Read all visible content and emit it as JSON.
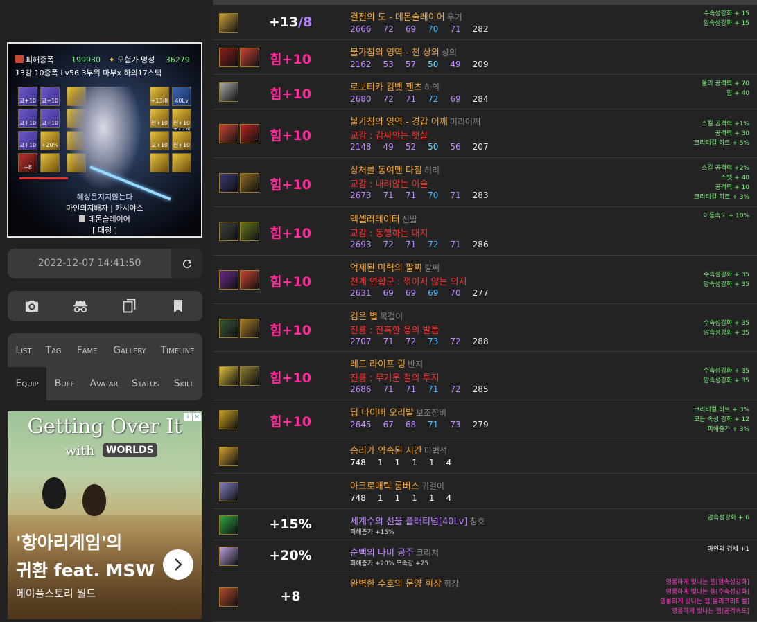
{
  "character": {
    "guild_icon": "guild-emblem-icon",
    "guild": "피해증폭",
    "guild_value": "199930",
    "fame_icon": "fame-icon",
    "fame_label": "모험가 명성",
    "fame_value": "36279",
    "summary": "13강 10증폭 Lv56 3부위 마부x 하의17스택",
    "title_text": "혜성은지지않는다",
    "adventure": "마인의지배자 | 카시야스",
    "name": "데몬슬레이어",
    "job": "[ 대청 ]",
    "slots": [
      "교+10",
      "교+10",
      "",
      "+13/8",
      "40Lv +15%",
      "교+10",
      "교+10",
      "",
      "천+10",
      "진+10",
      "교+10",
      "+20%",
      "",
      "교+10",
      "진+10",
      "+8",
      "",
      "",
      "",
      ""
    ]
  },
  "timestamp": "2022-12-07 14:41:50",
  "toolbar": {
    "icons": [
      "camera-icon",
      "incognito-icon",
      "copy-icon",
      "bookmark-icon"
    ]
  },
  "nav": {
    "row1": [
      "List",
      "Tag",
      "Fame",
      "Gallery",
      "Timeline"
    ],
    "row2": [
      "Equip",
      "Buff",
      "Avatar",
      "Status",
      "Skill"
    ],
    "active": "Equip"
  },
  "ad": {
    "title": "Getting Over It",
    "with": "with",
    "worlds": "WORLDS",
    "headline1": "'항아리게임'의",
    "headline2": "귀환 feat. MSW",
    "sub": "메이플스토리 월드",
    "info": "i",
    "close": "×"
  },
  "equipment": [
    {
      "level_plus": "+13",
      "level_frac": "/8",
      "name": "결전의 도 - 데몬슬레이어",
      "type": "무기",
      "stats": [
        "2666",
        "72",
        "69",
        "70",
        "71",
        "282"
      ],
      "right": [
        "수속성강화 + 15",
        "암속성강화 + 15"
      ]
    },
    {
      "power": "힘+10",
      "name": "불가침의 영역 - 천 상의",
      "type": "상의",
      "stats": [
        "2162",
        "53",
        "57",
        "50",
        "49",
        "209"
      ],
      "right": []
    },
    {
      "power": "힘+10",
      "name": "로보티카 컴뱃 팬츠",
      "type": "하의",
      "stats": [
        "2680",
        "72",
        "71",
        "72",
        "69",
        "284"
      ],
      "right": [
        "물리 공격력 + 70",
        "힘 + 40"
      ]
    },
    {
      "power": "힘+10",
      "name": "불가침의 영역 - 경갑 어깨",
      "type": "머리어깨",
      "sub": "교감 : 감싸안는 햇살",
      "stats": [
        "2148",
        "49",
        "52",
        "50",
        "56",
        "207"
      ],
      "right": [
        "스킬 공격력 +1%",
        "공격력 + 30",
        "크리티컬 히트 + 5%"
      ]
    },
    {
      "power": "힘+10",
      "name": "상처를 동여맨 다짐",
      "type": "허리",
      "sub": "교감 : 내려앉는 이슬",
      "stats": [
        "2673",
        "71",
        "71",
        "70",
        "71",
        "283"
      ],
      "right": [
        "스킬 공격력 +2%",
        "스탯 + 40",
        "공격력 + 10",
        "크리티컬 히트 + 3%"
      ]
    },
    {
      "power": "힘+10",
      "name": "엑셀러레이터",
      "type": "신발",
      "sub": "교감 : 동행하는 대지",
      "stats": [
        "2693",
        "72",
        "71",
        "72",
        "71",
        "286"
      ],
      "right": [
        "이동속도 + 10%"
      ]
    },
    {
      "power": "힘+10",
      "name": "억제된 마력의 팔찌",
      "type": "팔찌",
      "sub": "천계 연합군 : 꺾이지 않는 의지",
      "stats": [
        "2631",
        "69",
        "69",
        "69",
        "70",
        "277"
      ],
      "right": [
        "수속성강화 + 35",
        "암속성강화 + 35"
      ]
    },
    {
      "power": "힘+10",
      "name": "검은 별",
      "type": "목걸이",
      "sub": "진룡 : 잔혹한 용의 발톱",
      "stats": [
        "2707",
        "71",
        "72",
        "73",
        "72",
        "288"
      ],
      "right": [
        "수속성강화 + 35",
        "암속성강화 + 35"
      ]
    },
    {
      "power": "힘+10",
      "name": "레드 라이프 링",
      "type": "반지",
      "sub": "진룡 : 무거운 철의 투지",
      "stats": [
        "2686",
        "71",
        "71",
        "71",
        "72",
        "285"
      ],
      "right": [
        "수속성강화 + 35",
        "암속성강화 + 35"
      ]
    },
    {
      "power": "힘+10",
      "name": "딥 다이버 오리발",
      "type": "보조장비",
      "stats": [
        "2645",
        "67",
        "68",
        "71",
        "73",
        "279"
      ],
      "right": [
        "크리티컬 히트 + 3%",
        "모든 속성 강화 + 12",
        "피해증가 + 3%"
      ]
    },
    {
      "name": "승리가 약속된 시간",
      "type": "마법석",
      "stats": [
        "748",
        "1",
        "1",
        "1",
        "1",
        "4"
      ],
      "right": []
    },
    {
      "name": "아크로매틱 룸버스",
      "type": "귀걸이",
      "stats": [
        "748",
        "1",
        "1",
        "1",
        "1",
        "4"
      ],
      "right": []
    },
    {
      "level": "+15%",
      "name": "세계수의 선물 플래티넘",
      "name_lv": "[40Lv]",
      "type": "칭호",
      "extra": "피해증가 +15%",
      "right": [
        "암속성강화 + 6"
      ]
    },
    {
      "level": "+20%",
      "name": "순백의 나비 공주",
      "type": "크리쳐",
      "extra": "피해증가 +20% 모속강 +25",
      "right": [
        "마인의 검세 +1"
      ]
    },
    {
      "level": "+8",
      "name": "완벽한 수호의 문양 휘장",
      "type": "휘장",
      "right": [
        "영롱하게 빛나는 젬[암속성강화]",
        "영롱하게 빛나는 젬[수속성강화]",
        "영롱하게 빛나는 젬[물리크리티컬]",
        "영롱하게 빛나는 젬[공격속도]"
      ]
    }
  ],
  "colors": {
    "orange": "#f0a63a",
    "purple": "#c08cff",
    "red": "#ff3030",
    "green": "#7cf27c",
    "pink": "#ff2a9a"
  }
}
